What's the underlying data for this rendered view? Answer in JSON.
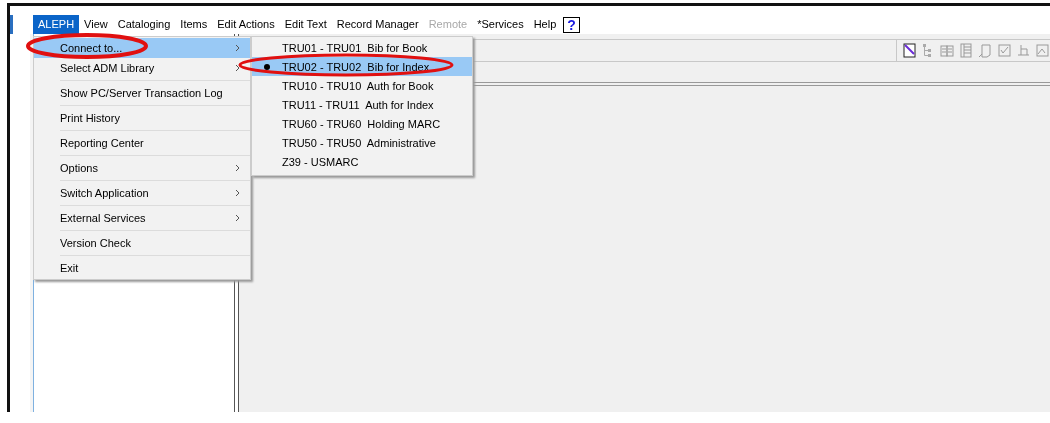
{
  "menubar": [
    {
      "label": "ALEPH",
      "selected": true,
      "disabled": false
    },
    {
      "label": "View",
      "selected": false,
      "disabled": false
    },
    {
      "label": "Cataloging",
      "selected": false,
      "disabled": false
    },
    {
      "label": "Items",
      "selected": false,
      "disabled": false
    },
    {
      "label": "Edit Actions",
      "selected": false,
      "disabled": false
    },
    {
      "label": "Edit Text",
      "selected": false,
      "disabled": false
    },
    {
      "label": "Record Manager",
      "selected": false,
      "disabled": false
    },
    {
      "label": "Remote",
      "selected": false,
      "disabled": true
    },
    {
      "label": "*Services",
      "selected": false,
      "disabled": false
    },
    {
      "label": "Help",
      "selected": false,
      "disabled": false
    }
  ],
  "help_button": "?",
  "menu": [
    {
      "label": "Connect to...",
      "selected": true,
      "has_submenu": true
    },
    {
      "label": "Select ADM Library",
      "selected": false,
      "has_submenu": true
    },
    {
      "label": "Show PC/Server Transaction Log",
      "selected": false,
      "has_submenu": false
    },
    {
      "label": "Print History",
      "selected": false,
      "has_submenu": false
    },
    {
      "label": "Reporting Center",
      "selected": false,
      "has_submenu": false
    },
    {
      "label": "Options",
      "selected": false,
      "has_submenu": true
    },
    {
      "label": "Switch Application",
      "selected": false,
      "has_submenu": true
    },
    {
      "label": "External Services",
      "selected": false,
      "has_submenu": true
    },
    {
      "label": "Version Check",
      "selected": false,
      "has_submenu": false
    },
    {
      "label": "Exit",
      "selected": false,
      "has_submenu": false
    }
  ],
  "submenu": [
    {
      "label": "TRU01 - TRU01  Bib for Book",
      "selected": false,
      "checked": false
    },
    {
      "label": "TRU02 - TRU02  Bib for Index",
      "selected": true,
      "checked": true
    },
    {
      "label": "TRU10 - TRU10  Auth for Book",
      "selected": false,
      "checked": false
    },
    {
      "label": "TRU11 - TRU11  Auth for Index",
      "selected": false,
      "checked": false
    },
    {
      "label": "TRU60 - TRU60  Holding MARC",
      "selected": false,
      "checked": false
    },
    {
      "label": "TRU50 - TRU50  Administrative",
      "selected": false,
      "checked": false
    },
    {
      "label": "Z39 - USMARC",
      "selected": false,
      "checked": false
    }
  ]
}
